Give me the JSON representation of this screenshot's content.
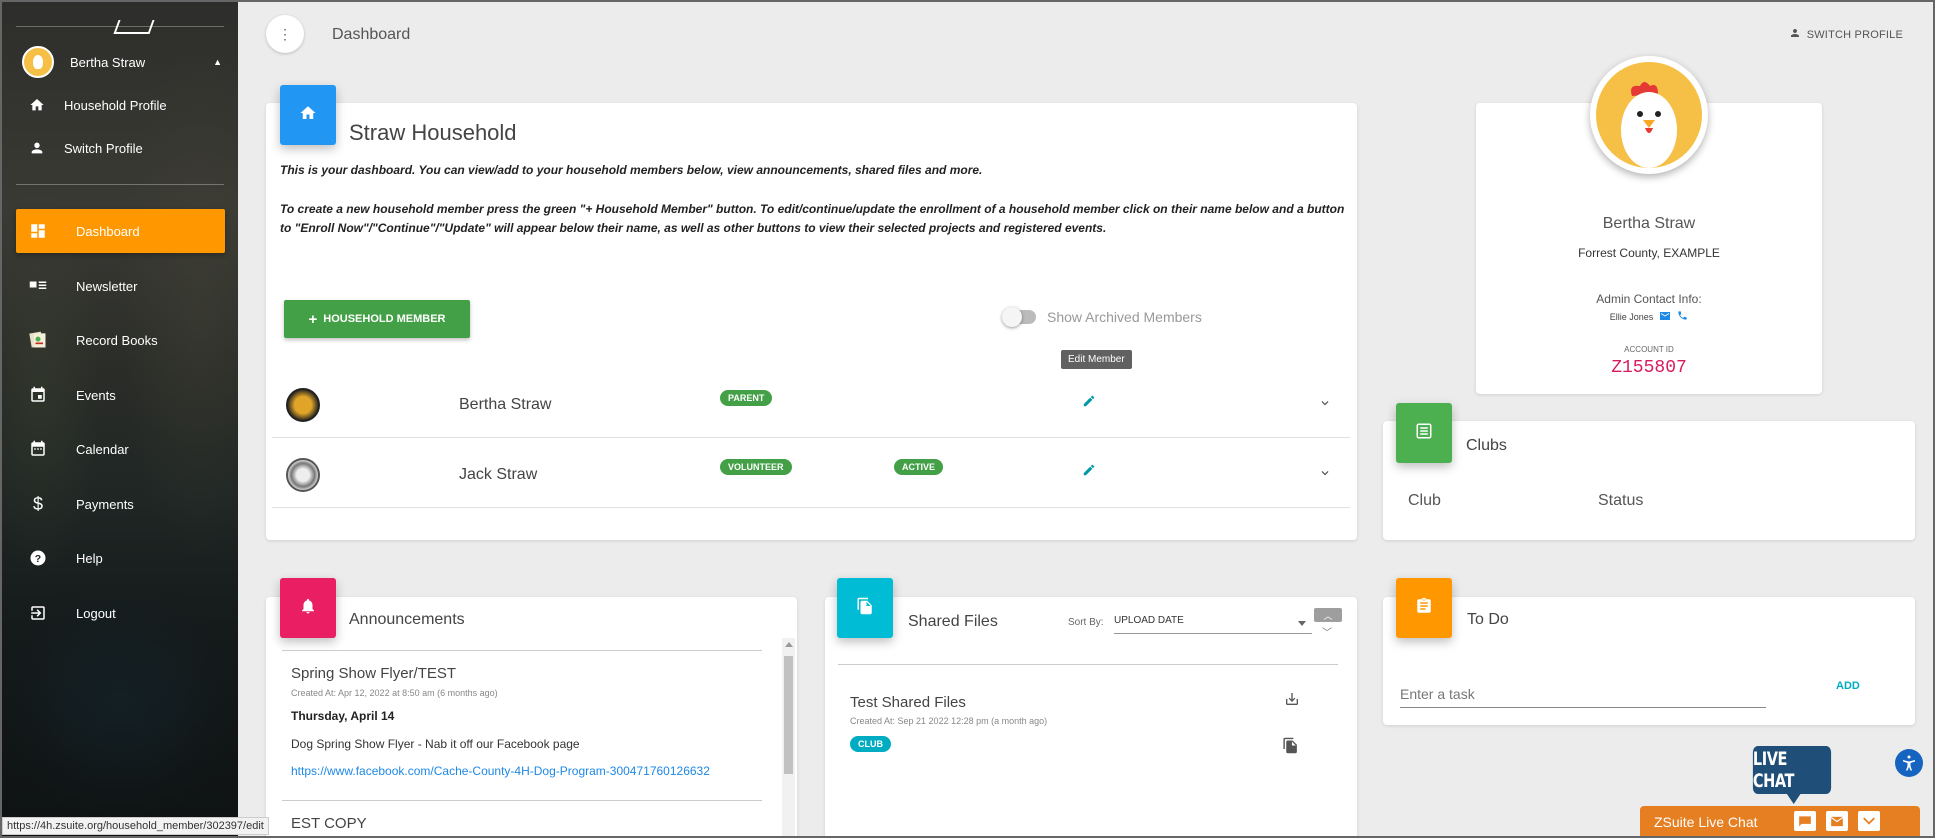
{
  "sidebar": {
    "user_name": "Bertha Straw",
    "sub_items": [
      {
        "label": "Household Profile",
        "icon": "home-icon"
      },
      {
        "label": "Switch Profile",
        "icon": "person-icon"
      }
    ],
    "nav": [
      {
        "label": "Dashboard",
        "icon": "dashboard-icon",
        "active": true
      },
      {
        "label": "Newsletter",
        "icon": "newsletter-icon"
      },
      {
        "label": "Record Books",
        "icon": "record-books-icon"
      },
      {
        "label": "Events",
        "icon": "event-icon"
      },
      {
        "label": "Calendar",
        "icon": "calendar-icon"
      },
      {
        "label": "Payments",
        "icon": "dollar-icon"
      },
      {
        "label": "Help",
        "icon": "help-icon"
      },
      {
        "label": "Logout",
        "icon": "logout-icon"
      }
    ]
  },
  "topbar": {
    "title": "Dashboard",
    "switch_profile": "SWITCH PROFILE"
  },
  "household": {
    "title": "Straw Household",
    "intro": "This is your dashboard. You can view/add to your household members below, view announcements, shared files and more.",
    "instructions": "To create a new household member press the green \"+ Household Member\" button. To edit/continue/update the enrollment of a household member click on their name below and a button to \"Enroll Now\"/\"Continue\"/\"Update\" will appear below their name, as well as other buttons to view their selected projects and registered events.",
    "add_button": "HOUSEHOLD MEMBER",
    "show_archived": "Show Archived Members",
    "tooltip": "Edit Member",
    "members": [
      {
        "name": "Bertha Straw",
        "role": "PARENT",
        "status": ""
      },
      {
        "name": "Jack Straw",
        "role": "VOLUNTEER",
        "status": "ACTIVE"
      }
    ]
  },
  "profile": {
    "name": "Bertha Straw",
    "county": "Forrest County, EXAMPLE",
    "admin_label": "Admin Contact Info:",
    "admin_name": "Ellie Jones",
    "account_label": "ACCOUNT ID",
    "account_id": "Z155807"
  },
  "clubs": {
    "title": "Clubs",
    "col_club": "Club",
    "col_status": "Status"
  },
  "announcements": {
    "title": "Announcements",
    "items": [
      {
        "title": "Spring Show Flyer/TEST",
        "created": "Created At: Apr 12, 2022 at 8:50 am (6 months ago)",
        "date": "Thursday, April 14",
        "body": "Dog Spring Show Flyer - Nab it off our Facebook page",
        "link": "https://www.facebook.com/Cache-County-4H-Dog-Program-300471760126632"
      },
      {
        "title": "EST COPY"
      }
    ]
  },
  "shared_files": {
    "title": "Shared Files",
    "sort_label": "Sort By:",
    "sort_value": "UPLOAD DATE",
    "files": [
      {
        "name": "Test Shared Files",
        "created": "Created At: Sep 21 2022 12:28 pm (a month ago)",
        "badge": "CLUB"
      }
    ]
  },
  "todo": {
    "title": "To Do",
    "placeholder": "Enter a task",
    "add": "ADD"
  },
  "status_url": "https://4h.zsuite.org/household_member/302397/edit",
  "livechat": {
    "bubble": "LIVE CHAT",
    "bar": "ZSuite Live Chat"
  },
  "colors": {
    "accent_orange": "#ff9800",
    "green": "#43a047",
    "blue": "#2196f3",
    "pink": "#e91e63",
    "cyan": "#00bcd4",
    "account_id": "#d81b60"
  }
}
